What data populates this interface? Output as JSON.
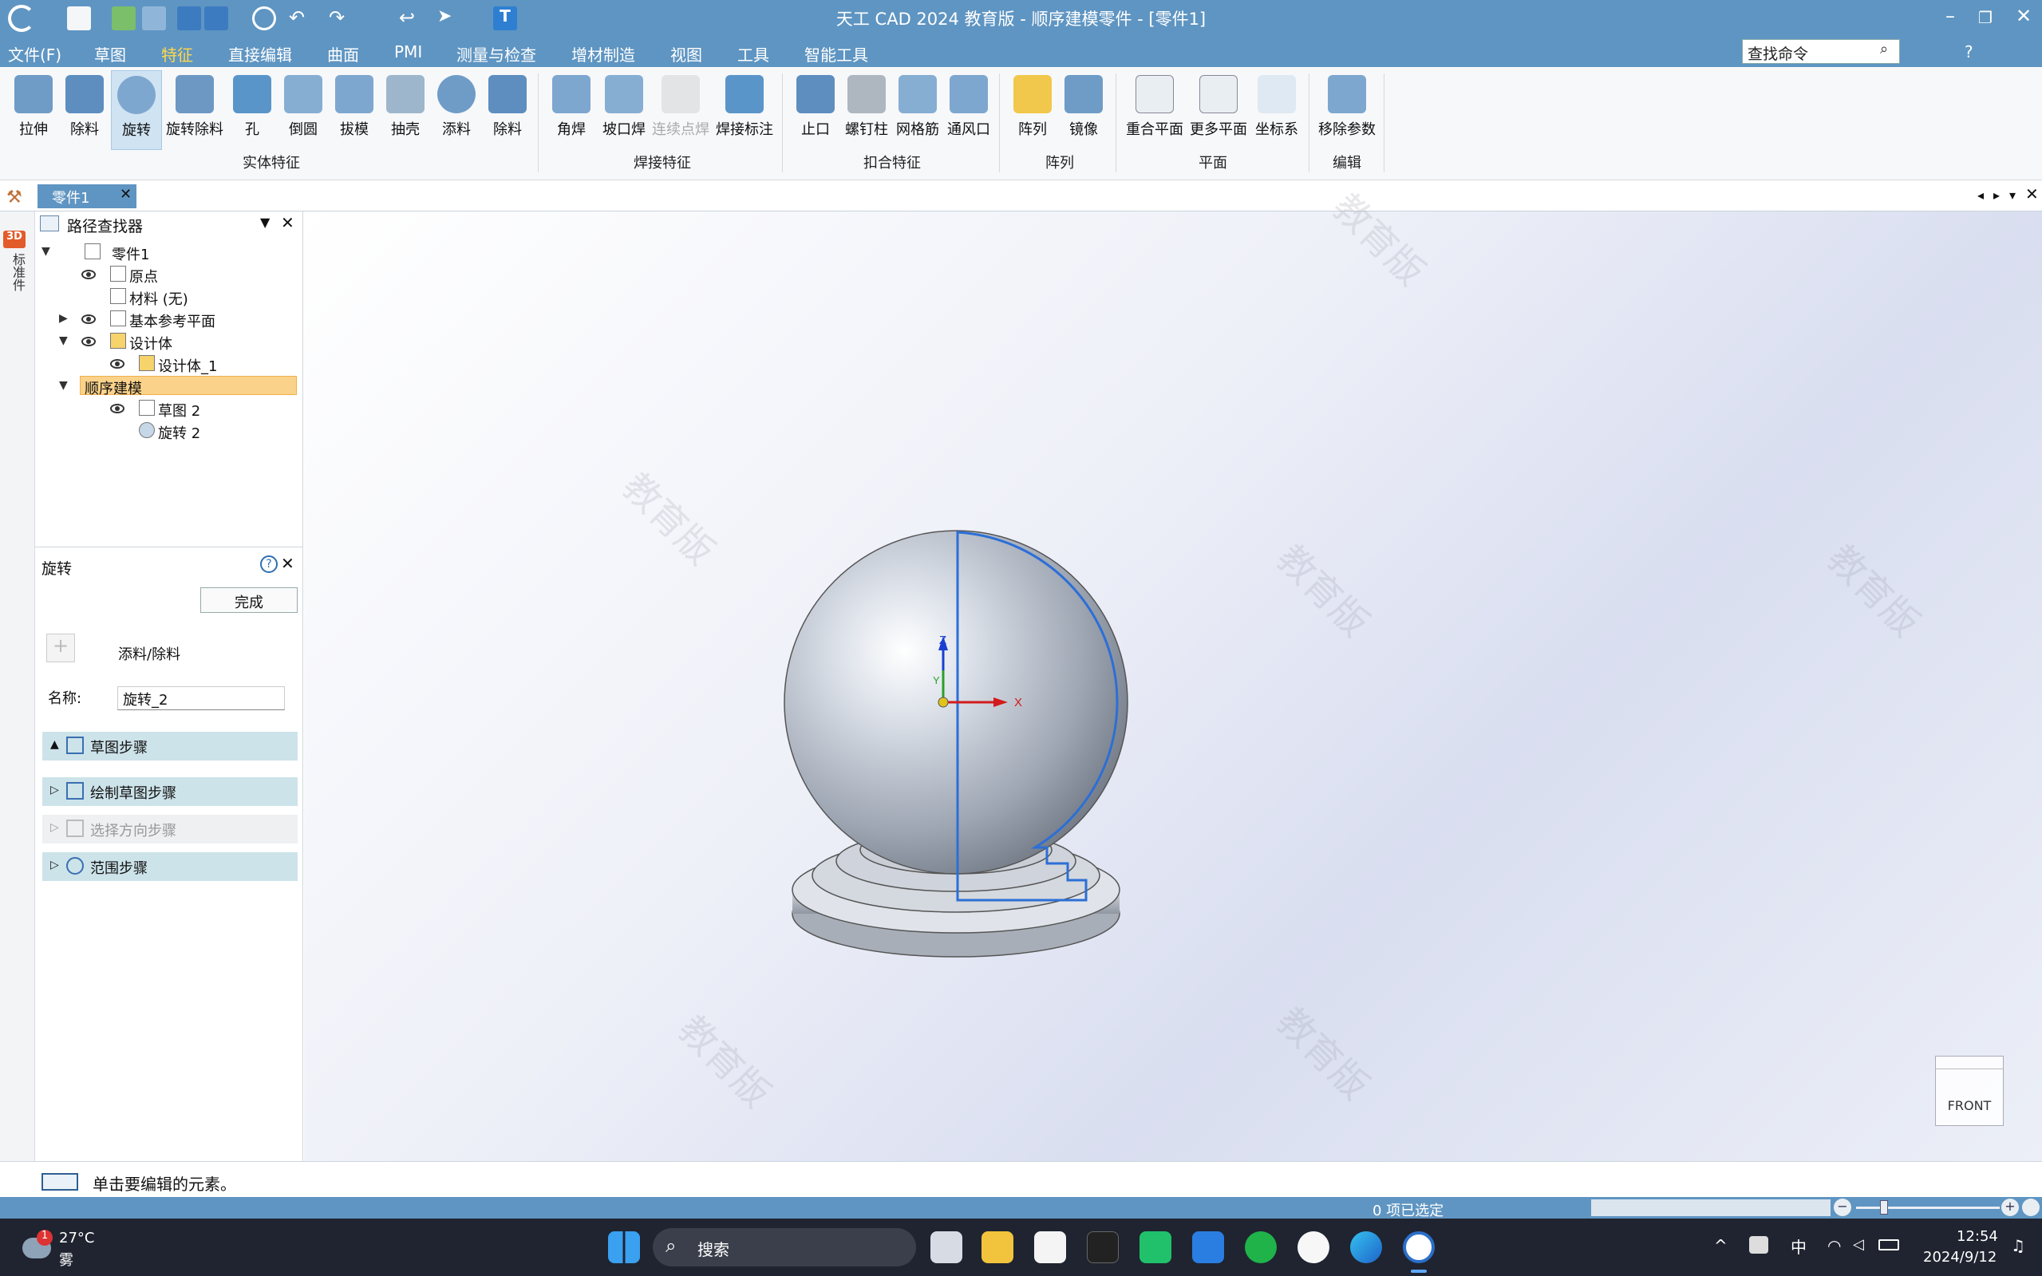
{
  "titlebar": {
    "title": "天工 CAD 2024 教育版 - 顺序建模零件 - [零件1]"
  },
  "menubar": {
    "items": [
      "文件(F)",
      "草图",
      "特征",
      "直接编辑",
      "曲面",
      "PMI",
      "测量与检查",
      "增材制造",
      "视图",
      "工具",
      "智能工具"
    ],
    "active": "特征",
    "search_value": "查找命令",
    "help": "?"
  },
  "ribbon": {
    "tools": [
      "拉伸",
      "除料",
      "旋转",
      "旋转除料",
      "孔",
      "倒圆",
      "拔模",
      "抽壳",
      "添料",
      "除料",
      "角焊",
      "坡口焊",
      "连续点焊",
      "焊接标注",
      "止口",
      "螺钉柱",
      "网格筋",
      "通风口",
      "阵列",
      "镜像",
      "重合平面",
      "更多平面",
      "坐标系",
      "移除参数"
    ],
    "groups": [
      "实体特征",
      "焊接特征",
      "扣合特征",
      "阵列",
      "平面",
      "编辑"
    ]
  },
  "doc_tab": {
    "label": "零件1"
  },
  "side_tab": {
    "badge": "3D",
    "label": "标准件"
  },
  "pathfinder": {
    "title": "路径查找器",
    "nodes": [
      "零件1",
      "原点",
      "材料 (无)",
      "基本参考平面",
      "设计体",
      "设计体_1",
      "顺序建模",
      "草图 2",
      "旋转 2"
    ]
  },
  "revolve_panel": {
    "title": "旋转",
    "finish": "完成",
    "add_remove": "添料/除料",
    "name_label": "名称:",
    "name_value": "旋转_2",
    "steps": [
      "草图步骤",
      "绘制草图步骤",
      "选择方向步骤",
      "范围步骤"
    ]
  },
  "viewport": {
    "watermark": "教育版",
    "axes": {
      "z": "Z",
      "x": "X",
      "y": "Y"
    },
    "view_cube": "FRONT"
  },
  "status": {
    "prompt": "单击要编辑的元素。",
    "selection": "0 项已选定"
  },
  "taskbar": {
    "weather_temp": "27°C",
    "weather_desc": "雾",
    "weather_badge": "1",
    "search": "搜索",
    "ime": "中",
    "time": "12:54",
    "date": "2024/9/12"
  }
}
